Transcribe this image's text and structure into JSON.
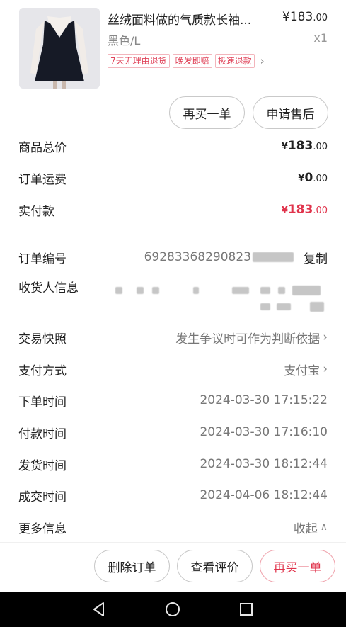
{
  "product": {
    "name": "丝绒面料做的气质款长袖...",
    "price_main": "¥183",
    "price_cents": ".00",
    "variant": "黑色/L",
    "quantity": "x1",
    "tags": [
      "7天无理由退货",
      "晚发即赔",
      "极速退款"
    ]
  },
  "actions": {
    "buy_again": "再买一单",
    "after_sales": "申请售后"
  },
  "summary": {
    "goods_total_label": "商品总价",
    "goods_total_main": "183",
    "goods_total_cents": ".00",
    "shipping_label": "订单运费",
    "shipping_main": "0",
    "shipping_cents": ".00",
    "paid_label": "实付款",
    "paid_main": "183",
    "paid_cents": ".00",
    "currency": "¥"
  },
  "info": {
    "order_no_label": "订单编号",
    "order_no_value": "69283368290823",
    "copy_label": "复制",
    "receiver_label": "收货人信息",
    "snapshot_label": "交易快照",
    "snapshot_value": "发生争议时可作为判断依据",
    "payment_label": "支付方式",
    "payment_value": "支付宝",
    "order_time_label": "下单时间",
    "order_time_value": "2024-03-30 17:15:22",
    "pay_time_label": "付款时间",
    "pay_time_value": "2024-03-30 17:16:10",
    "ship_time_label": "发货时间",
    "ship_time_value": "2024-03-30 18:12:44",
    "deal_time_label": "成交时间",
    "deal_time_value": "2024-04-06 18:12:44",
    "more_label": "更多信息",
    "collapse_label": "收起"
  },
  "bottom": {
    "delete_order": "删除订单",
    "view_review": "查看评价",
    "buy_again": "再买一单"
  },
  "colors": {
    "accent_red": "#e0344c",
    "tag_red": "#e0445a"
  },
  "icons": [
    "back-icon",
    "home-icon",
    "recents-icon",
    "chevron-right-icon",
    "chevron-up-icon"
  ]
}
